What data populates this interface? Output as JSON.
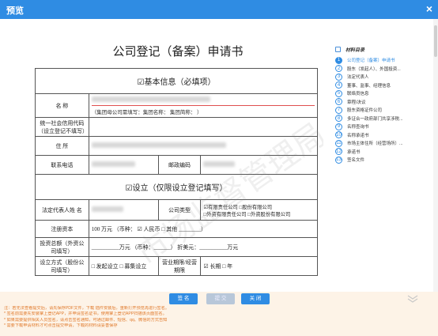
{
  "window": {
    "title": "预览",
    "close_glyph": "×"
  },
  "doc": {
    "title": "公司登记（备案）申请书",
    "section1": "☑基本信息（必填项）",
    "name_label": "名        称",
    "name_hint": "（集团母公司需填写：集团名称：                                  集团简称：                              ）",
    "credit_code_label": "统一社会信用代码（设立登记不填写）",
    "address_label": "住        所",
    "phone_label": "联系电话",
    "postcode_label": "邮政编码",
    "section2": "☑设立（仅限设立登记填写）",
    "legal_rep_label": "法定代表人姓    名",
    "company_type_label": "公司类型",
    "company_type_options": "☑有限责任公司          □股份有限公司\n□外资有限责任公司 □外资股份有限公司",
    "registered_capital_label": "注册资本",
    "registered_capital_value": "100 万元  （币种：  ☑ 人民币  □  其他  ________）",
    "investment_label": "投资总额（外资公司填写）",
    "investment_value": "__________万元  （币种：______）    折美元：__________万元",
    "establish_method_label": "设立方式（股份公司填写）",
    "establish_method_value": "□ 发起设立    □ 募集设立",
    "business_term_label": "营业期限/经营期限",
    "business_term_value": "☑ 长期 □          年"
  },
  "watermark_text": "市场监督管理局",
  "toc": {
    "header": "材料目录",
    "items": [
      {
        "num": "1",
        "label": "公司登记（备案）申请书",
        "active": true
      },
      {
        "num": "2",
        "label": "股东（发起人）、外国投资..."
      },
      {
        "num": "3",
        "label": "法定代表人"
      },
      {
        "num": "4",
        "label": "董事、监事、经理信息"
      },
      {
        "num": "5",
        "label": "联络员信息"
      },
      {
        "num": "6",
        "label": "章程/决议"
      },
      {
        "num": "7",
        "label": "股东资格证件公司"
      },
      {
        "num": "8",
        "label": "多证合一政府部门共享涉税..."
      },
      {
        "num": "9",
        "label": "名称查询书"
      },
      {
        "num": "10",
        "label": "名称承诺书"
      },
      {
        "num": "11",
        "label": "市场主体住所（经营场所）..."
      },
      {
        "num": "12",
        "label": "承诺书"
      },
      {
        "num": "13",
        "label": "签名文件"
      }
    ]
  },
  "buttons": {
    "sign": "签  名",
    "middle": "提  交",
    "close": "关  闭"
  },
  "notes": [
    "注：若无法查看提交后，请先保存PDF文件，下载  插件安装后，重新打开预览再进行签名。",
    "* 签名前需要先安装掌上登记APP，并申请签名证书，使用掌上登记APP扫描该页面签名。",
    "* 如果需要提供相关人员签名，请点击签名通知，可通过邮件、短信、qq、微信的方式告知",
    "* 需要下载申请材料才可点击提交申请，下载的材料请妥善保存"
  ],
  "colors": {
    "accent": "#2f8ce3",
    "notes": "#e07a2c",
    "bottom_bg": "#fdf3e7"
  }
}
